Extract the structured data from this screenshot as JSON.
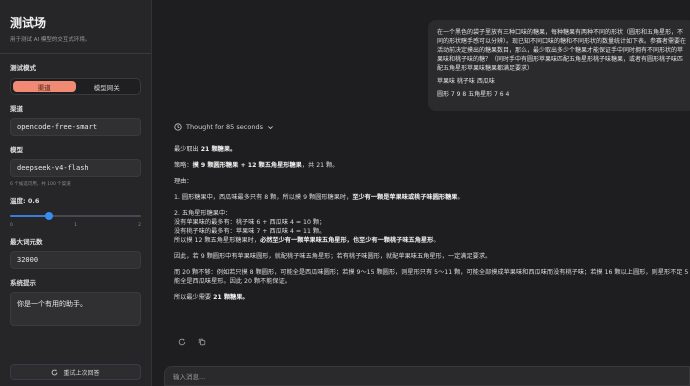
{
  "app": {
    "title": "测试场",
    "subtitle": "用于测试 AI 模型的交互式环境。"
  },
  "sidebar": {
    "mode_label": "测试模式",
    "tabs": [
      {
        "label": "渠道",
        "active": true
      },
      {
        "label": "模型网关",
        "active": false
      }
    ],
    "channel_label": "渠道",
    "channel_value": "opencode-free-smart",
    "model_label": "模型",
    "model_value": "deepseek-v4-flash",
    "model_hint": "6 个候选可用，共 100 个渠道",
    "temperature_label": "温度: 0.6",
    "temperature_value": 0.6,
    "temperature_min": "0",
    "temperature_mid": "1",
    "temperature_max": "2",
    "max_tokens_label": "最大词元数",
    "max_tokens_value": "32000",
    "system_prompt_label": "系统提示",
    "system_prompt_value": "你是一个有用的助手。",
    "reset_label": "重试上次回答",
    "reset_icon": "refresh-icon"
  },
  "chat": {
    "user_message": {
      "para1": "在一个黑色的袋子里放有三种口味的糖果，每种糖果有两种不同的形状（圆形和五角星形，不同的形状瞎手感可以分辨）。现已知不同口味的糖和不同形状的数量统计如下表。参赛者需要在活动前决定摸出的糖果数目，那么，最少取出多少个糖果才能保证手中同时拥有不同形状的苹果味和桃子味的糖？（同时手中有圆形苹果味匹配五角星形桃子味糖果，或者有圆形桃子味匹配五角星形苹果味糖果都满足要求）",
      "para2": "苹果味 桃子味 西瓜味",
      "para3": "圆形 7 9 8 五角星形 7 6 4"
    },
    "thought_label": "Thought for 85 seconds",
    "response": {
      "l1_pre": "最少取出 ",
      "l1_bold": "21 颗糖果。",
      "l2_pre": "策略：",
      "l2_bold": "摸 9 颗圆形糖果 + 12 颗五角星形糖果",
      "l2_post": "，共 21 颗。",
      "l3": "理由：",
      "l4_pre": "1. 圆形糖果中，西瓜味最多只有 8 颗，所以摸 9 颗圆形糖果时，",
      "l4_bold": "至少有一颗是苹果味或桃子味圆形糖果",
      "l4_post": "。",
      "l5": "2. 五角星形糖果中：",
      "l6": "没有苹果味的最多有：桃子味 6 + 西瓜味 4 = 10 颗；",
      "l7": "没有桃子味的最多有：苹果味 7 + 西瓜味 4 = 11 颗。",
      "l8_pre": "所以摸 12 颗五角星形糖果时，",
      "l8_bold": "必然至少有一颗苹果味五角星形，也至少有一颗桃子味五角星形",
      "l8_post": "。",
      "l9": "因此，若 9 颗圆形中有苹果味圆形，就配桃子味五角星形；若有桃子味圆形，就配苹果味五角星形，一定满足要求。",
      "l10": "而 20 颗不够：例如若只摸 8 颗圆形，可能全是西瓜味圆形；若摸 9～15 颗圆形，则星形只有 5～11 颗，可能全部摸成苹果味和西瓜味而没有桃子味；若摸 16 颗以上圆形，则星形不足 5 颗，可能全是西瓜味星形。因此 20 颗不能保证。",
      "l11_pre": "所以最少需要 ",
      "l11_bold": "21 颗糖果。"
    },
    "input_placeholder": "输入消息..."
  },
  "colors": {
    "accent": "#f08a75",
    "slider": "#3a8cf0",
    "background": "#1e1e20",
    "sidebar": "#262628"
  }
}
